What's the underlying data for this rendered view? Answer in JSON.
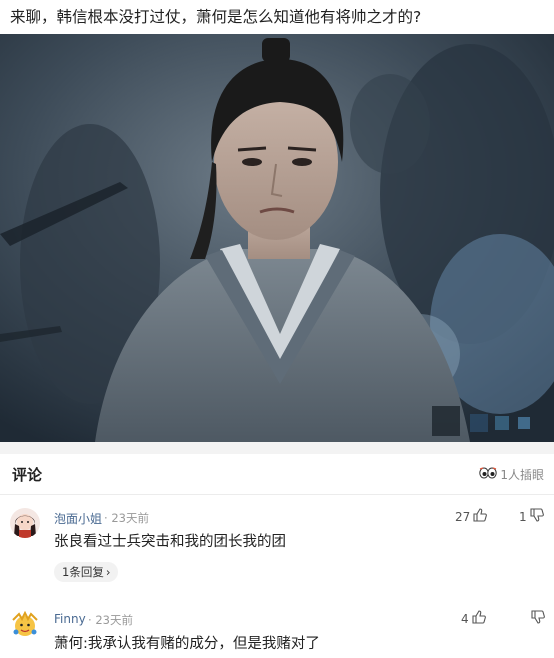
{
  "post": {
    "title": "来聊，韩信根本没打过仗，萧何是怎么知道他有将帅之才的?"
  },
  "hero_image": {
    "description_icon": "drama-still-image"
  },
  "comments_section": {
    "title": "评论",
    "likes_summary": "1人插眼",
    "likes_icon": "eyes-icon"
  },
  "comments": [
    {
      "username": "泡面小姐",
      "time": "23天前",
      "text": "张良看过士兵突击和我的团长我的团",
      "like_count": "27",
      "dislike_count": "1",
      "reply_label": "1条回复",
      "reply_chevron": "›"
    },
    {
      "username": "Finny",
      "time": "23天前",
      "text": "萧何:我承认我有赌的成分，但是我赌对了",
      "like_count": "4",
      "dislike_count": ""
    }
  ],
  "colors": {
    "username": "#4a6a92",
    "meta": "#999999",
    "accent_divider": "#f3f3f3"
  }
}
